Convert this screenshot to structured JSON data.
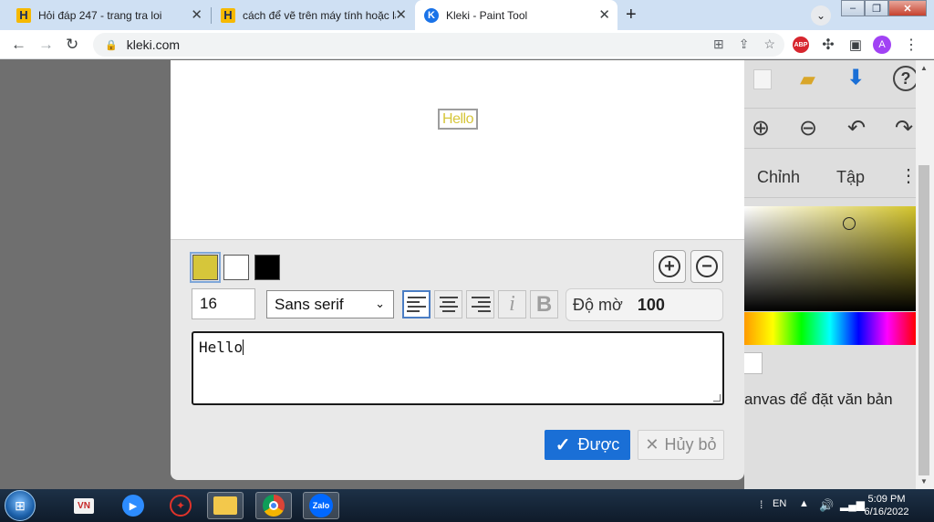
{
  "browser": {
    "tabs": [
      {
        "title": "Hỏi đáp 247 - trang tra loi",
        "favicon": "hoidap-icon"
      },
      {
        "title": "cách để vẽ trên máy tính hoặc lap",
        "favicon": "hoidap-icon"
      },
      {
        "title": "Kleki - Paint Tool",
        "favicon": "kleki-icon"
      }
    ],
    "url": "kleki.com",
    "profile_initial": "A",
    "abp_label": "ABP"
  },
  "kleki_panel": {
    "tab_adjust": "Chỉnh",
    "tab_layers": "Tập",
    "hint": "anvas để đặt văn bản"
  },
  "text_dialog": {
    "preview_text": "Hello",
    "colors": [
      "#d6c63a",
      "#ffffff",
      "#000000"
    ],
    "size_value": "16",
    "font_value": "Sans serif",
    "italic_label": "i",
    "bold_label": "B",
    "opacity_label": "Độ mờ",
    "opacity_value": "100",
    "text_value": "Hello",
    "ok_label": "Được",
    "cancel_label": "Hủy bỏ"
  },
  "taskbar": {
    "language": "EN",
    "zalo_label": "Zalo",
    "time": "5:09 PM",
    "date": "6/16/2022"
  }
}
